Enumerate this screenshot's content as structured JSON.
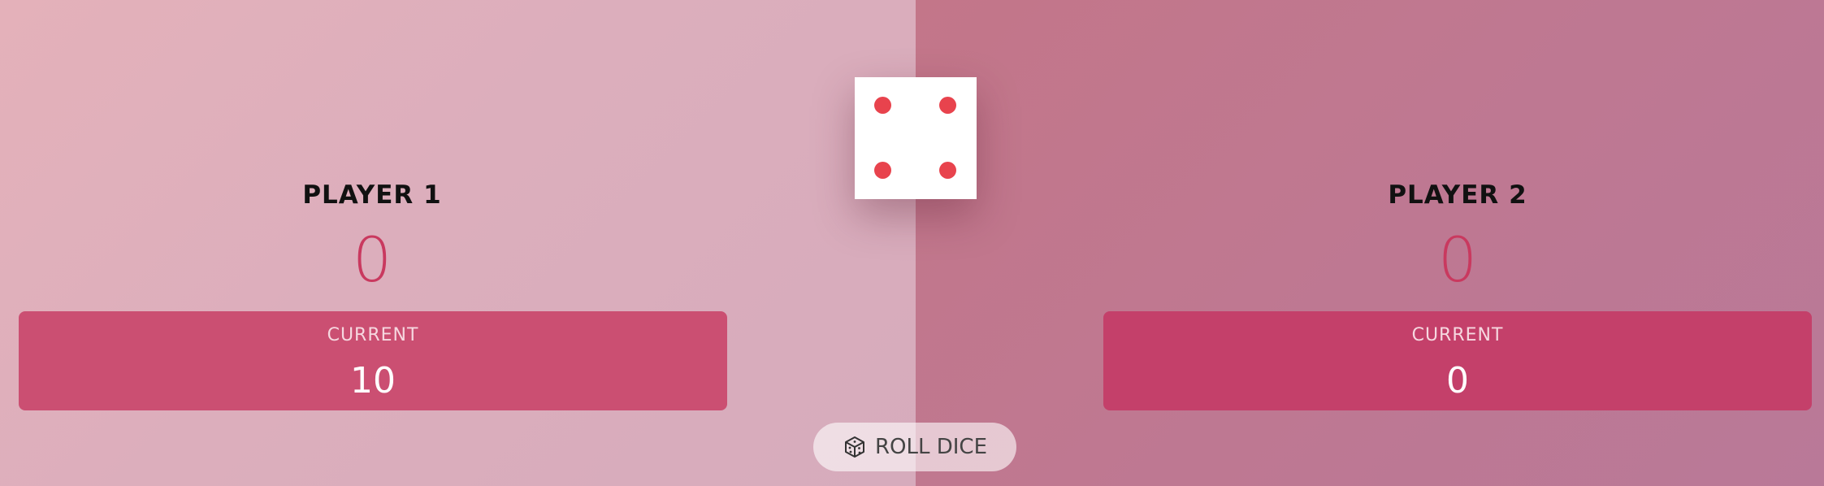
{
  "players": [
    {
      "name": "PLAYER 1",
      "score": "0",
      "current_label": "CURRENT",
      "current_score": "10"
    },
    {
      "name": "PLAYER 2",
      "score": "0",
      "current_label": "CURRENT",
      "current_score": "0"
    }
  ],
  "dice": {
    "value": 4,
    "pip_color": "#e8434d"
  },
  "controls": {
    "roll_label": "ROLL DICE",
    "roll_icon": "dice-icon"
  },
  "colors": {
    "left_panel": "#e0aebb",
    "right_panel": "#c07890",
    "score": "#c9395f",
    "current_box_p1": "#cb4f72",
    "current_box_p2": "#c4406a"
  }
}
